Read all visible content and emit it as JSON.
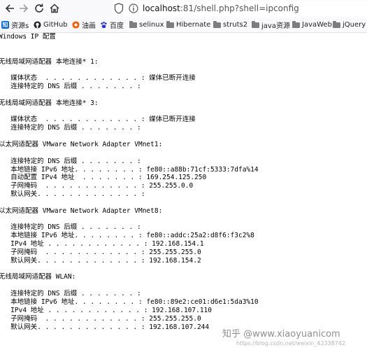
{
  "browser": {
    "url_host": "localhost",
    "url_rest": ":81/shell.php?shell=ipconfig",
    "bookmarks": [
      {
        "icon": "zhihu-icon",
        "label": "资源s"
      },
      {
        "icon": "github-icon",
        "label": "GitHub"
      },
      {
        "icon": "taobao-icon",
        "label": "油画"
      },
      {
        "icon": "baidu-icon",
        "label": "百度"
      },
      {
        "icon": "folder-icon",
        "label": "selinux"
      },
      {
        "icon": "folder-icon",
        "label": "Hibernate"
      },
      {
        "icon": "folder-icon",
        "label": "struts2"
      },
      {
        "icon": "folder-icon",
        "label": "java资源"
      },
      {
        "icon": "folder-icon",
        "label": "JavaWeb"
      },
      {
        "icon": "folder-icon",
        "label": "jQuery"
      }
    ]
  },
  "output_lines": [
    "Windows IP 配置",
    "",
    "",
    "无线局域网适配器 本地连接* 1:",
    "",
    "   媒体状态  . . . . . . . . . . . . : 媒体已断开连接",
    "   连接特定的 DNS 后缀 . . . . . . . :",
    "",
    "无线局域网适配器 本地连接* 3:",
    "",
    "   媒体状态  . . . . . . . . . . . . : 媒体已断开连接",
    "   连接特定的 DNS 后缀 . . . . . . . :",
    "",
    "以太网适配器 VMware Network Adapter VMnet1:",
    "",
    "   连接特定的 DNS 后缀 . . . . . . . :",
    "   本地链接 IPv6 地址. . . . . . . . : fe80::a88b:71cf:5333:7dfa%14",
    "   自动配置 IPv4 地址  . . . . . . . : 169.254.125.250",
    "   子网掩码  . . . . . . . . . . . . : 255.255.0.0",
    "   默认网关. . . . . . . . . . . . . :",
    "",
    "以太网适配器 VMware Network Adapter VMnet8:",
    "",
    "   连接特定的 DNS 后缀 . . . . . . . :",
    "   本地链接 IPv6 地址. . . . . . . . : fe80::addc:25a2:d8f6:f3c2%8",
    "   IPv4 地址 . . . . . . . . . . . . : 192.168.154.1",
    "   子网掩码  . . . . . . . . . . . . : 255.255.255.0",
    "   默认网关. . . . . . . . . . . . . : 192.168.154.2",
    "",
    "无线局域网适配器 WLAN:",
    "",
    "   连接特定的 DNS 后缀 . . . . . . . :",
    "   本地链接 IPv6 地址. . . . . . . . : fe80::89e2:ce01:d6e1:5da3%10",
    "   IPv4 地址 . . . . . . . . . . . . : 192.168.107.110",
    "   子网掩码  . . . . . . . . . . . . : 255.255.255.0",
    "   默认网关. . . . . . . . . . . . . : 192.168.107.244"
  ],
  "watermark": {
    "main": "知乎 @www.xiaoyuanicom",
    "sub": "https://blog.csdn.net/weixin_42338742"
  }
}
